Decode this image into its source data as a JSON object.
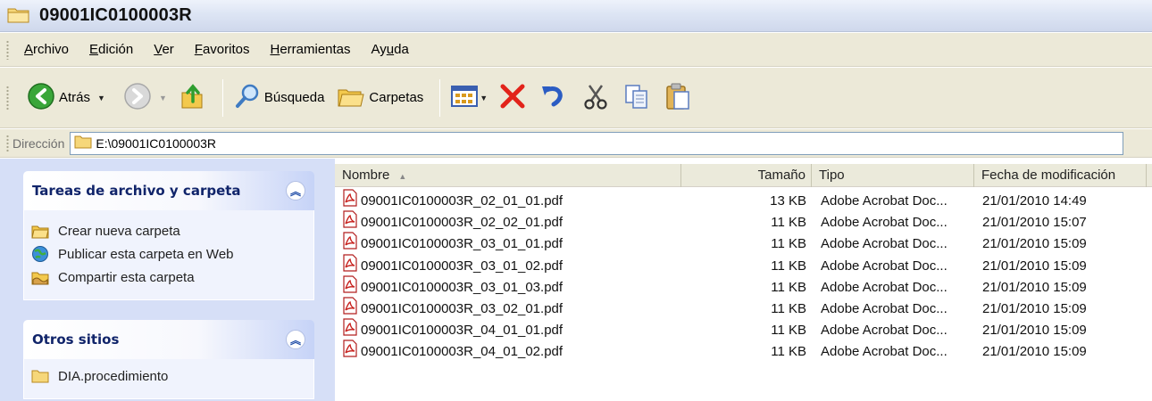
{
  "window": {
    "title": "09001IC0100003R"
  },
  "menu": [
    {
      "pre": "",
      "u": "A",
      "post": "rchivo"
    },
    {
      "pre": "",
      "u": "E",
      "post": "dición"
    },
    {
      "pre": "",
      "u": "V",
      "post": "er"
    },
    {
      "pre": "",
      "u": "F",
      "post": "avoritos"
    },
    {
      "pre": "",
      "u": "H",
      "post": "erramientas"
    },
    {
      "pre": "Ay",
      "u": "u",
      "post": "da"
    }
  ],
  "toolbar": {
    "back_label": "Atrás",
    "search_label": "Búsqueda",
    "folders_label": "Carpetas"
  },
  "address": {
    "label": "Dirección",
    "value": "E:\\09001IC0100003R"
  },
  "tasks_panel": {
    "title": "Tareas de archivo y carpeta",
    "items": [
      {
        "label": "Crear nueva carpeta",
        "icon": "new-folder-icon"
      },
      {
        "label": "Publicar esta carpeta en Web",
        "icon": "publish-web-icon"
      },
      {
        "label": "Compartir esta carpeta",
        "icon": "share-folder-icon"
      }
    ]
  },
  "other_places": {
    "title": "Otros sitios",
    "items": [
      {
        "label": "DIA.procedimiento",
        "icon": "folder-icon"
      }
    ]
  },
  "columns": {
    "name": "Nombre",
    "size": "Tamaño",
    "type": "Tipo",
    "date": "Fecha de modificación"
  },
  "files": [
    {
      "name": "09001IC0100003R_02_01_01.pdf",
      "size": "13 KB",
      "type": "Adobe Acrobat Doc...",
      "date": "21/01/2010 14:49"
    },
    {
      "name": "09001IC0100003R_02_02_01.pdf",
      "size": "11 KB",
      "type": "Adobe Acrobat Doc...",
      "date": "21/01/2010 15:07"
    },
    {
      "name": "09001IC0100003R_03_01_01.pdf",
      "size": "11 KB",
      "type": "Adobe Acrobat Doc...",
      "date": "21/01/2010 15:09"
    },
    {
      "name": "09001IC0100003R_03_01_02.pdf",
      "size": "11 KB",
      "type": "Adobe Acrobat Doc...",
      "date": "21/01/2010 15:09"
    },
    {
      "name": "09001IC0100003R_03_01_03.pdf",
      "size": "11 KB",
      "type": "Adobe Acrobat Doc...",
      "date": "21/01/2010 15:09"
    },
    {
      "name": "09001IC0100003R_03_02_01.pdf",
      "size": "11 KB",
      "type": "Adobe Acrobat Doc...",
      "date": "21/01/2010 15:09"
    },
    {
      "name": "09001IC0100003R_04_01_01.pdf",
      "size": "11 KB",
      "type": "Adobe Acrobat Doc...",
      "date": "21/01/2010 15:09"
    },
    {
      "name": "09001IC0100003R_04_01_02.pdf",
      "size": "11 KB",
      "type": "Adobe Acrobat Doc...",
      "date": "21/01/2010 15:09"
    }
  ],
  "colors": {
    "pane_bg": "#d6dff7",
    "panel_title": "#10246a",
    "chrome": "#ece9d8"
  }
}
